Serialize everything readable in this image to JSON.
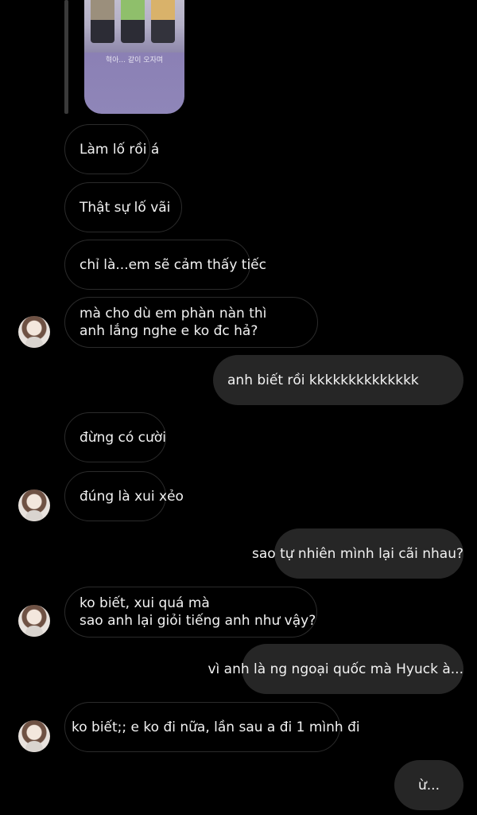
{
  "shared_post": {
    "caption": "혁아... 같이 오자며"
  },
  "messages": [
    {
      "text": "Làm lố rồi á"
    },
    {
      "text": "Thật sự lố vãi"
    },
    {
      "text": "chỉ là...em sẽ cảm thấy tiếc"
    },
    {
      "lines": [
        "mà cho dù em phàn nàn thì",
        "anh lắng nghe e ko đc hả?"
      ]
    },
    {
      "text": "anh biết rồi kkkkkkkkkkkkkk"
    },
    {
      "text": "đừng có cười"
    },
    {
      "text": "đúng là xui xẻo"
    },
    {
      "text": "sao tự nhiên mình lại cãi nhau?"
    },
    {
      "lines": [
        "ko biết, xui quá mà",
        "sao anh lại giỏi tiếng anh như vậy?"
      ]
    },
    {
      "text": "vì anh là ng ngoại quốc mà Hyuck à..."
    },
    {
      "text": "ko biết;; e ko đi nữa, lần sau a đi 1 mình đi"
    },
    {
      "text": "ừ..."
    }
  ]
}
